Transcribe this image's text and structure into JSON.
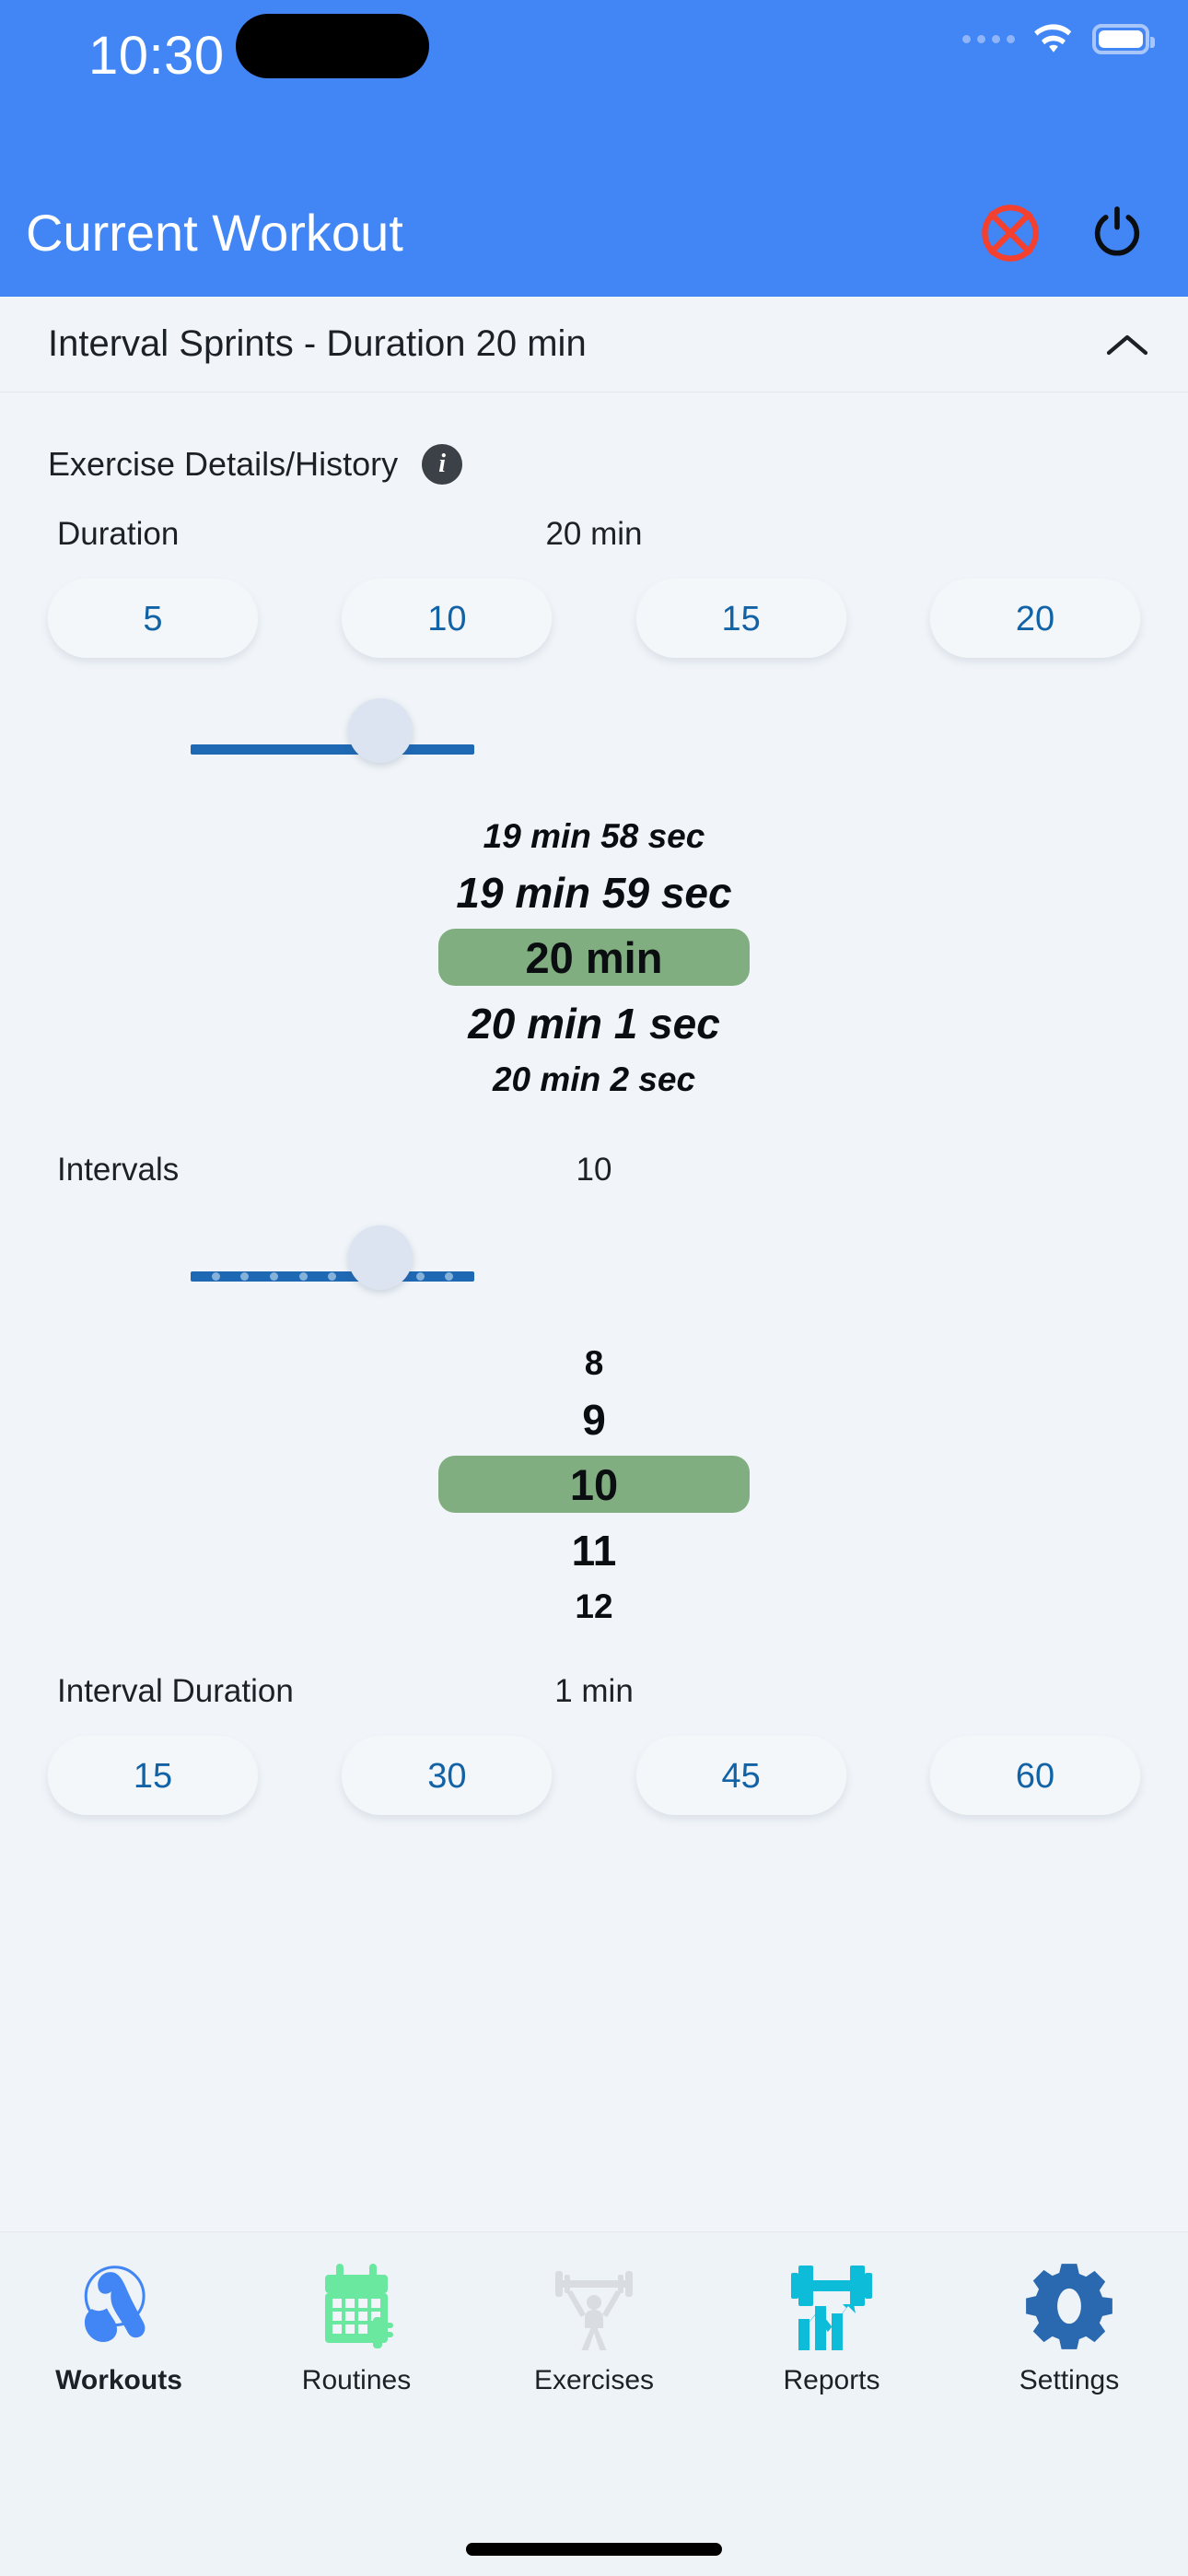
{
  "status_bar": {
    "time": "10:30",
    "signal_icon": "cellular-dots-icon",
    "wifi_icon": "wifi-icon",
    "battery_icon": "battery-icon"
  },
  "nav_bar": {
    "title": "Current Workout",
    "cancel_icon": "cancel-circle-x-icon",
    "power_icon": "power-icon",
    "background_color": "#4285f4",
    "cancel_color": "#f4402e",
    "power_color": "#0b0e11"
  },
  "exercise": {
    "title": "Interval Sprints - Duration 20 min",
    "collapse_icon": "chevron-up-icon",
    "details_label": "Exercise Details/History",
    "info_icon": "info-icon"
  },
  "fields": [
    {
      "name": "Duration",
      "value": "20 min",
      "presets": [
        "5",
        "10",
        "15",
        "20"
      ],
      "slider": {
        "value": 20,
        "min": 5,
        "max": 30,
        "fill_percent": 55,
        "ticks": false
      },
      "wheel": {
        "items": [
          "19 min 58 sec",
          "19 min 59 sec",
          "20 min",
          "20 min 1 sec",
          "20 min 2 sec"
        ],
        "selected_index": 2,
        "selected_color": "#81ae80"
      }
    },
    {
      "name": "Intervals",
      "value": "10",
      "presets": [],
      "slider": {
        "value": 10,
        "min": 1,
        "max": 20,
        "fill_percent": 55,
        "ticks": true
      },
      "wheel": {
        "items": [
          "8",
          "9",
          "10",
          "11",
          "12"
        ],
        "selected_index": 2,
        "selected_color": "#81ae80"
      }
    },
    {
      "name": "Interval Duration",
      "value": "1 min",
      "presets": [
        "15",
        "30",
        "45",
        "60"
      ],
      "slider": null,
      "wheel": null
    }
  ],
  "tabs": [
    {
      "label": "Workouts",
      "icon": "bicep-flex-icon",
      "active": true,
      "color": "#4285f4"
    },
    {
      "label": "Routines",
      "icon": "calendar-icon",
      "active": false,
      "color": "#6ae8a0"
    },
    {
      "label": "Exercises",
      "icon": "weightlifter-icon",
      "active": false,
      "color": "#d9dde1"
    },
    {
      "label": "Reports",
      "icon": "dumbbell-chart-icon",
      "active": false,
      "color": "#0dbcd8"
    },
    {
      "label": "Settings",
      "icon": "gear-icon",
      "active": false,
      "color": "#2a68b0"
    }
  ],
  "home_indicator": "home-bar"
}
